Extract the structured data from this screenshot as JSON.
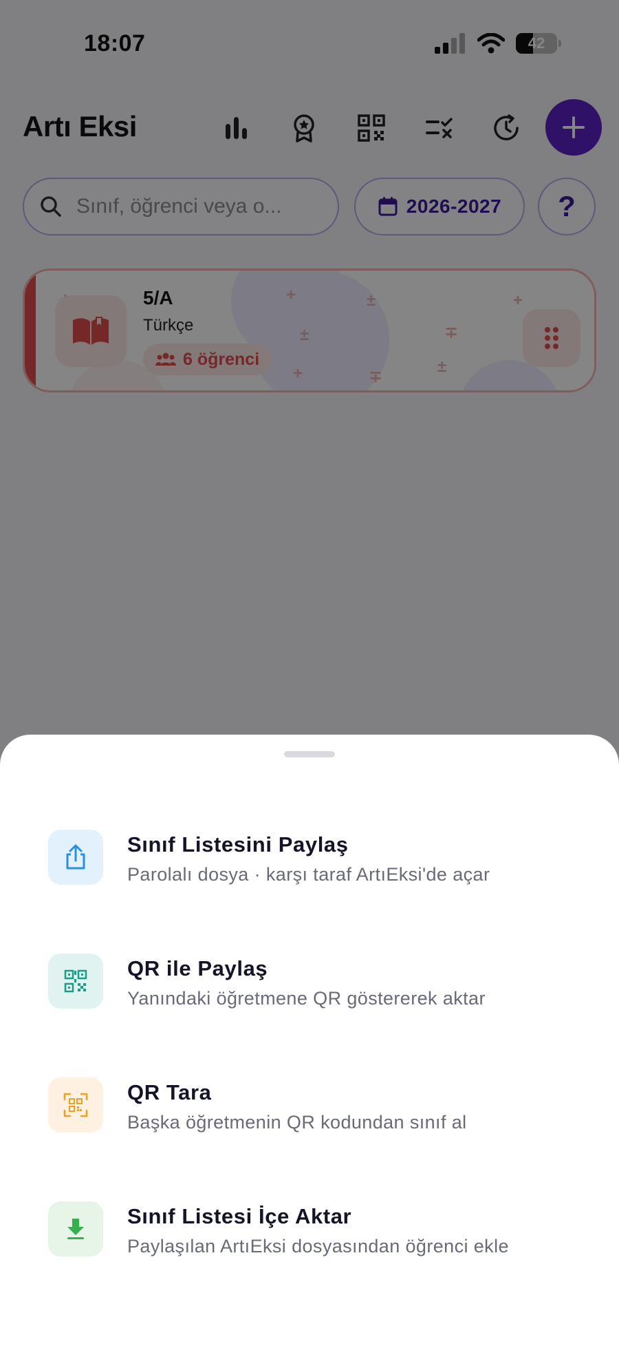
{
  "status_bar": {
    "time": "18:07",
    "battery": "42"
  },
  "header": {
    "title": "Artı Eksi"
  },
  "search": {
    "placeholder": "Sınıf, öğrenci veya o..."
  },
  "year": {
    "label": "2026-2027"
  },
  "help": {
    "label": "?"
  },
  "class_card": {
    "title": "5/A",
    "subject": "Türkçe",
    "students": "6 öğrenci"
  },
  "sheet": {
    "items": [
      {
        "title": "Sınıf Listesini Paylaş",
        "subtitle": "Parolalı dosya · karşı taraf ArtıEksi'de açar"
      },
      {
        "title": "QR ile Paylaş",
        "subtitle": "Yanındaki öğretmene QR göstererek aktar"
      },
      {
        "title": "QR Tara",
        "subtitle": "Başka öğretmenin QR kodundan sınıf al"
      },
      {
        "title": "Sınıf Listesi İçe Aktar",
        "subtitle": "Paylaşılan ArtıEksi dosyasından öğrenci ekle"
      }
    ]
  },
  "colors": {
    "accent": "#5b22c5",
    "card_accent": "#e34d4d",
    "share_bg": "#e3f1fd",
    "share_fg": "#2b8fe0",
    "qr_bg": "#e0f3f1",
    "qr_fg": "#1c9b8a",
    "scan_bg": "#fff1e2",
    "scan_fg": "#f0a020",
    "import_bg": "#e6f5e8",
    "import_fg": "#36b04c"
  }
}
